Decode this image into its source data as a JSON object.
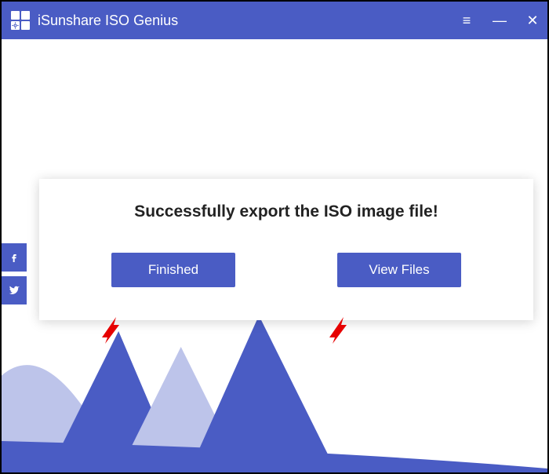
{
  "titlebar": {
    "app_name": "iSunshare ISO Genius",
    "controls": {
      "menu": "≡",
      "minimize": "—",
      "close": "✕"
    }
  },
  "dialog": {
    "message": "Successfully export the ISO image file!",
    "finished_label": "Finished",
    "view_files_label": "View Files"
  },
  "social": {
    "facebook": "facebook",
    "twitter": "twitter"
  },
  "colors": {
    "primary": "#4a5cc4",
    "arrow": "#e60000"
  }
}
